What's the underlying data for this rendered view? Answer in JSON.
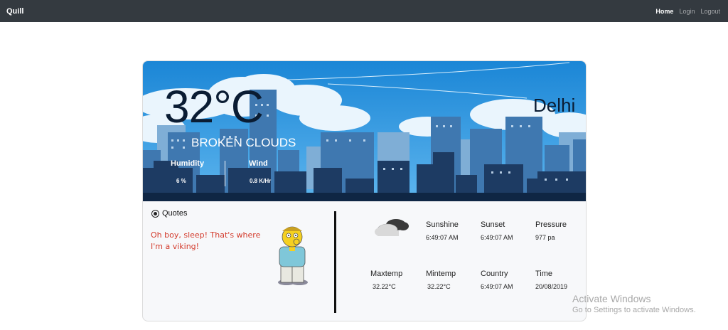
{
  "navbar": {
    "brand": "Quill",
    "links": [
      {
        "label": "Home"
      },
      {
        "label": "Login"
      },
      {
        "label": "Logout"
      }
    ]
  },
  "weather": {
    "temperature": "32°C",
    "city": "Delhi",
    "description": "BROKEN CLOUDS",
    "humidity_label": "Humidity",
    "humidity_value": "6 %",
    "wind_label": "Wind",
    "wind_value": "0.8 K/Hr"
  },
  "quotes": {
    "heading": "Quotes",
    "text": "Oh boy, sleep! That's where I'm a viking!"
  },
  "details": {
    "sunshine_label": "Sunshine",
    "sunshine_value": "6:49:07 AM",
    "sunset_label": "Sunset",
    "sunset_value": "6:49:07 AM",
    "pressure_label": "Pressure",
    "pressure_value": "977 pa",
    "maxtemp_label": "Maxtemp",
    "maxtemp_value": "32.22°C",
    "mintemp_label": "Mintemp",
    "mintemp_value": "32.22°C",
    "country_label": "Country",
    "country_value": "6:49:07 AM",
    "time_label": "Time",
    "time_value": "20/08/2019"
  },
  "icons": {
    "weather_icon": "cloud-icon",
    "quote_icon": "radio-icon",
    "character": "ralph-wiggum-illustration"
  },
  "colors": {
    "navbar": "#343a40",
    "sky": "#1e8ad8",
    "quote_text": "#d33b2c",
    "temperature": "#0a1c33"
  },
  "watermark": {
    "title": "Activate Windows",
    "subtitle": "Go to Settings to activate Windows."
  }
}
